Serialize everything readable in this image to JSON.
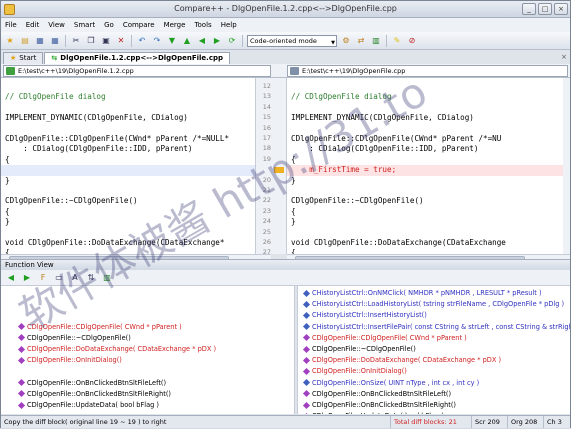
{
  "window": {
    "title": "Compare++ - DlgOpenFile.1.2.cpp<-->DlgOpenFile.cpp"
  },
  "menu": [
    "File",
    "Edit",
    "View",
    "Smart",
    "Go",
    "Compare",
    "Merge",
    "Tools",
    "Help"
  ],
  "toolbar": {
    "mode": "Code-oriented mode"
  },
  "tabs": [
    {
      "label": "Start",
      "active": false
    },
    {
      "label": "DlgOpenFile.1.2.cpp<-->DlgOpenFile.cpp",
      "active": true
    }
  ],
  "left_path": "E:\\test\\c++\\19\\DlgOpenFile.1.2.cpp",
  "right_path": "E:\\test\\c++\\19\\DlgOpenFile.cpp",
  "left_lines": [
    "",
    "// CDlgOpenFile dialog",
    "",
    "IMPLEMENT_DYNAMIC(CDlgOpenFile, CDialog)",
    "",
    "CDlgOpenFile::CDlgOpenFile(CWnd* pParent /*=NULL*",
    "    : CDialog(CDlgOpenFile::IDD, pParent)",
    "{",
    "",
    "}",
    "",
    "CDlgOpenFile::~CDlgOpenFile()",
    "{",
    "}",
    "",
    "void CDlgOpenFile::DoDataExchange(CDataExchange*",
    "{"
  ],
  "right_lines": [
    "",
    "// CDlgOpenFile dialog",
    "",
    "IMPLEMENT_DYNAMIC(CDlgOpenFile, CDialog)",
    "",
    "CDlgOpenFile::CDlgOpenFile(CWnd* pParent /*=NU",
    "    : CDialog(CDlgOpenFile::IDD, pParent)",
    "{",
    "    m_FirstTime = true;",
    "}",
    "",
    "CDlgOpenFile::~CDlgOpenFile()",
    "{",
    "}",
    "",
    "void CDlgOpenFile::DoDataExchange(CDataExchange",
    "{"
  ],
  "left_numbers": [
    "12",
    "13",
    "14",
    "15",
    "16",
    "17",
    "18",
    "19",
    "",
    "20",
    "21",
    "22",
    "23",
    "24",
    "25",
    "26",
    "27"
  ],
  "right_numbers": [
    "",
    "",
    "",
    "",
    "",
    "",
    "",
    "",
    "",
    "",
    "",
    "",
    "",
    "",
    "",
    "",
    ""
  ],
  "function_view": {
    "title": "Function View",
    "left": [
      {
        "text": "",
        "color": "black"
      },
      {
        "text": "",
        "color": "black"
      },
      {
        "text": "",
        "color": "black"
      },
      {
        "text": "CDlgOpenFile::CDlgOpenFile( CWnd * pParent )",
        "color": "red"
      },
      {
        "text": "CDlgOpenFile::~CDlgOpenFile()",
        "color": "black"
      },
      {
        "text": "CDlgOpenFile::DoDataExchange( CDataExchange * pDX )",
        "color": "red"
      },
      {
        "text": "CDlgOpenFile::OnInitDialog()",
        "color": "red"
      },
      {
        "text": "",
        "color": "black"
      },
      {
        "text": "CDlgOpenFile::OnBnClickedBtnSltFileLeft()",
        "color": "black"
      },
      {
        "text": "CDlgOpenFile::OnBnClickedBtnSltFileRight()",
        "color": "black"
      },
      {
        "text": "CDlgOpenFile::UpdateData( bool bFlag )",
        "color": "black"
      }
    ],
    "right": [
      {
        "text": "CHistoryListCtrl::OnNMClick( NMHDR * pNMHDR , LRESULT * pResult )",
        "color": "blue"
      },
      {
        "text": "CHistoryListCtrl::LoadHistoryList( tstring strFileName , CDlgOpenFile * pDlg )",
        "color": "blue"
      },
      {
        "text": "CHistoryListCtrl::InsertHistoryList()",
        "color": "blue"
      },
      {
        "text": "CHistoryListCtrl::InsertFilePair( const CString & strLeft , const CString & strRight",
        "color": "blue"
      },
      {
        "text": "CDlgOpenFile::CDlgOpenFile( CWnd * pParent )",
        "color": "red"
      },
      {
        "text": "CDlgOpenFile::~CDlgOpenFile()",
        "color": "black"
      },
      {
        "text": "CDlgOpenFile::DoDataExchange( CDataExchange * pDX )",
        "color": "red"
      },
      {
        "text": "CDlgOpenFile::OnInitDialog()",
        "color": "red"
      },
      {
        "text": "CDlgOpenFile::OnSize( UINT nType , int cx , int cy )",
        "color": "blue"
      },
      {
        "text": "CDlgOpenFile::OnBnClickedBtnSltFileLeft()",
        "color": "black"
      },
      {
        "text": "CDlgOpenFile::OnBnClickedBtnSltFileRight()",
        "color": "black"
      },
      {
        "text": "CDlgOpenFile::UpdateData( bool bFlag )",
        "color": "black"
      }
    ]
  },
  "status": {
    "message": "Copy the diff block( original line 19 ~ 19 ) to right",
    "diff_blocks": "Total diff blocks: 21",
    "scr": "Scr 209",
    "org": "Org 208",
    "ch": "Ch 3"
  },
  "watermark": "软件体被酱 http://31.to"
}
